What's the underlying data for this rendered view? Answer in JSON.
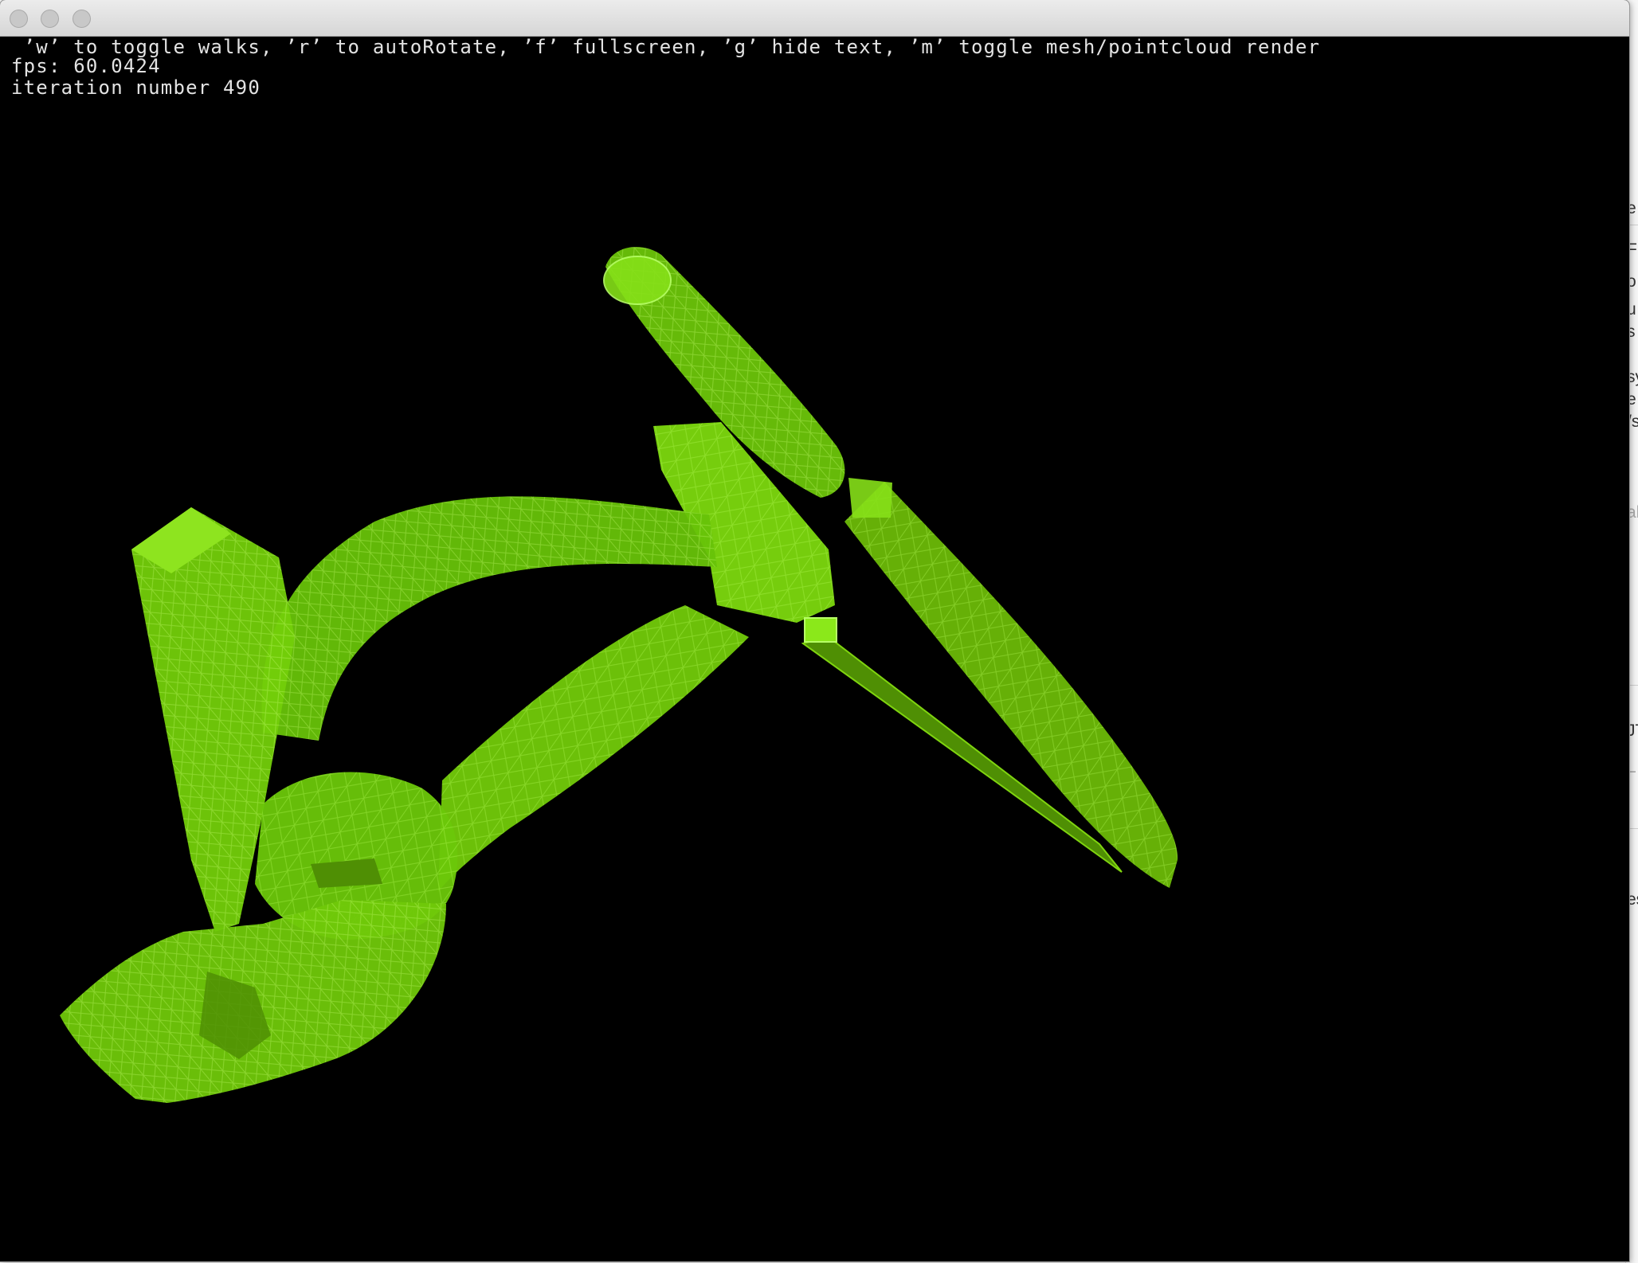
{
  "window": {
    "title": "",
    "controls": {
      "close": "close",
      "minimize": "minimize",
      "zoom": "zoom"
    }
  },
  "overlay": {
    "help": " ’w’ to toggle walks, ’r’ to autoRotate, ’f’ fullscreen, ’g’ hide text, ’m’ toggle mesh/pointcloud render",
    "fps": "fps: 60.0424",
    "iteration": "iteration number 490"
  },
  "scene": {
    "render_mode": "mesh",
    "background": "#000000",
    "mesh_color": "#7ad40b",
    "mesh_dark": "#5a9d05",
    "mesh_light": "#9ef22a"
  },
  "background_window": {
    "fragments": [
      "e",
      "F",
      "o",
      "u",
      "s",
      "sy",
      "e",
      "/s",
      "al",
      "JT",
      "L",
      "es"
    ]
  }
}
